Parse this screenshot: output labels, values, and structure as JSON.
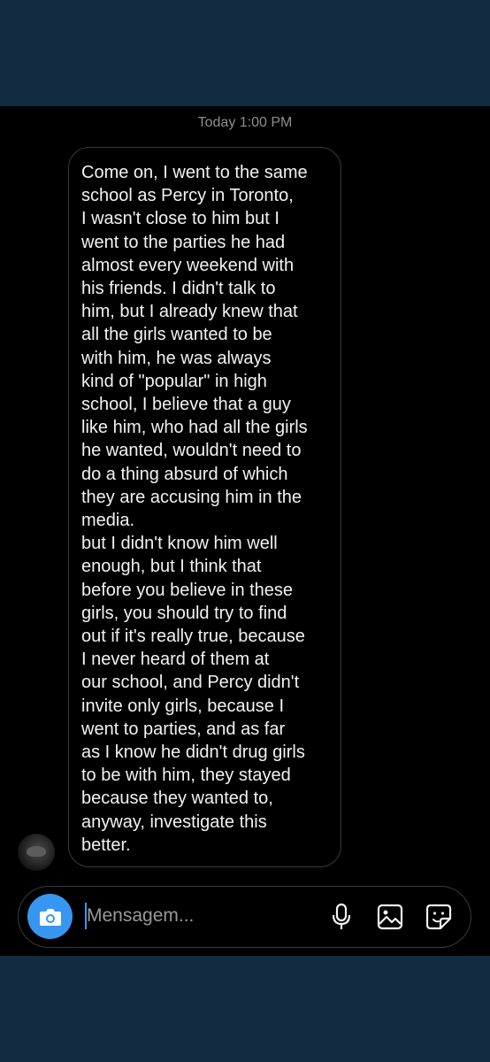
{
  "chat": {
    "timestamp": "Today 1:00 PM",
    "message": {
      "text": "Come on, I went to the same\nschool as Percy in Toronto,\nI wasn't close to him but I\nwent to the parties he had\nalmost every weekend with\nhis friends. I didn't talk to\nhim, but I already knew that\nall the girls wanted to be\nwith him, he was always\nkind of \"popular\" in high\nschool, I believe that a guy\nlike him, who had all the girls\nhe wanted, wouldn't need to\ndo a thing absurd of which\nthey are accusing him in the\nmedia.\nbut I didn't know him well\nenough, but I think that\nbefore you believe in these\ngirls, you should try to find\nout if it's really true, because\nI never heard of them at\nour school, and Percy didn't\ninvite only girls, because I\nwent to parties, and as far\nas I know he didn't drug girls\nto be with him, they stayed\nbecause they wanted to,\nanyway, investigate this\nbetter."
    }
  },
  "composer": {
    "placeholder": "Mensagem...",
    "value": "",
    "icons": {
      "camera": "camera-icon",
      "mic": "microphone-icon",
      "gallery": "gallery-icon",
      "sticker": "sticker-icon"
    }
  },
  "colors": {
    "background_band": "#122b41",
    "chat_background": "#000000",
    "bubble_border": "#3a3a3a",
    "text": "#f2f2f2",
    "accent": "#3797f0",
    "timestamp": "#8e8e8e"
  }
}
